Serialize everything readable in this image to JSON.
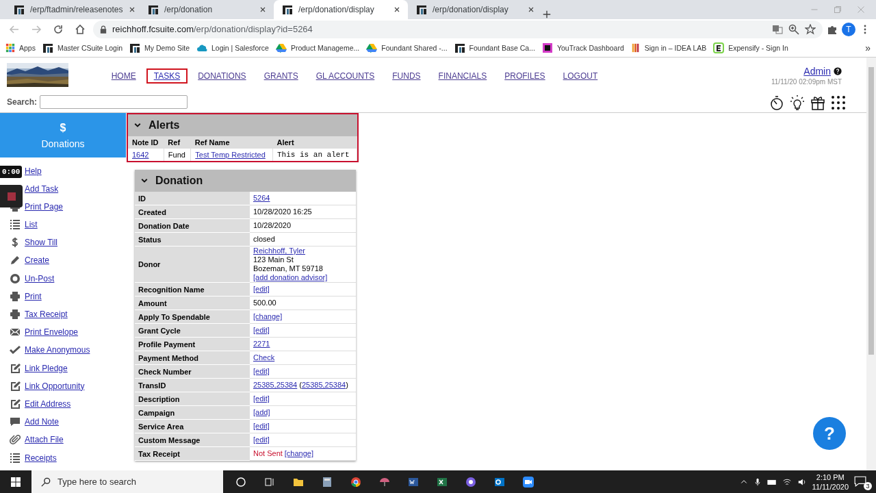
{
  "browser": {
    "tabs": [
      {
        "title": "/erp/ftadmin/releasenotes",
        "selected": false
      },
      {
        "title": "/erp/donation",
        "selected": false
      },
      {
        "title": "/erp/donation/display",
        "selected": true
      },
      {
        "title": "/erp/donation/display",
        "selected": false
      }
    ],
    "address": {
      "domain": "reichhoff.fcsuite.com",
      "path": "/erp/donation/display?id=5264"
    },
    "profile": "T",
    "bookmarks": [
      {
        "label": "Apps",
        "kind": "apps"
      },
      {
        "label": "Master CSuite Login",
        "kind": "site"
      },
      {
        "label": "My Demo Site",
        "kind": "site"
      },
      {
        "label": "Login | Salesforce",
        "kind": "cloud"
      },
      {
        "label": "Product Manageme...",
        "kind": "drive"
      },
      {
        "label": "Foundant Shared -...",
        "kind": "drive"
      },
      {
        "label": "Foundant Base Ca...",
        "kind": "site"
      },
      {
        "label": "YouTrack Dashboard",
        "kind": "youtrack"
      },
      {
        "label": "Sign in – IDEA LAB",
        "kind": "idea"
      },
      {
        "label": "Expensify - Sign In",
        "kind": "expensify"
      }
    ],
    "more": "»"
  },
  "header": {
    "nav": [
      {
        "label": "HOME",
        "selected": false
      },
      {
        "label": "TASKS",
        "selected": true
      },
      {
        "label": "DONATIONS",
        "selected": false
      },
      {
        "label": "GRANTS",
        "selected": false
      },
      {
        "label": "GL ACCOUNTS",
        "selected": false
      },
      {
        "label": "FUNDS",
        "selected": false
      },
      {
        "label": "FINANCIALS",
        "selected": false
      },
      {
        "label": "PROFILES",
        "selected": false
      },
      {
        "label": "LOGOUT",
        "selected": false
      }
    ],
    "user": "Admin",
    "timestamp": "11/11/20 02:09pm MST",
    "search_label": "Search:"
  },
  "sidebar": {
    "symbol": "$",
    "title": "Donations",
    "items": [
      "Help",
      "Add Task",
      "Print Page",
      "List",
      "Show Till",
      "Create",
      "Un-Post",
      "Print",
      "Tax Receipt",
      "Print Envelope",
      "Make Anonymous",
      "Link Pledge",
      "Link Opportunity",
      "Edit Address",
      "Add Note",
      "Attach File",
      "Receipts"
    ]
  },
  "alerts": {
    "title": "Alerts",
    "columns": [
      "Note ID",
      "Ref",
      "Ref Name",
      "Alert"
    ],
    "rows": [
      [
        "1642",
        "Fund",
        "Test Temp Restricted",
        "This is an alert"
      ]
    ]
  },
  "donation": {
    "title": "Donation",
    "rows": [
      {
        "label": "ID",
        "lines": [
          [
            {
              "text": "5264",
              "kind": "link"
            }
          ]
        ]
      },
      {
        "label": "Created",
        "lines": [
          [
            {
              "text": "10/28/2020 16:25",
              "kind": "text"
            }
          ]
        ]
      },
      {
        "label": "Donation Date",
        "lines": [
          [
            {
              "text": "10/28/2020",
              "kind": "text"
            }
          ]
        ]
      },
      {
        "label": "Status",
        "lines": [
          [
            {
              "text": "closed",
              "kind": "text"
            }
          ]
        ]
      },
      {
        "label": "Donor",
        "lines": [
          [
            {
              "text": "Reichhoff, Tyler",
              "kind": "link"
            }
          ],
          [
            {
              "text": "123 Main St",
              "kind": "text"
            }
          ],
          [
            {
              "text": "Bozeman, MT 59718",
              "kind": "text"
            }
          ],
          [
            {
              "text": "[add donation advisor]",
              "kind": "link"
            }
          ]
        ]
      },
      {
        "label": "Recognition Name",
        "lines": [
          [
            {
              "text": "[edit]",
              "kind": "link"
            }
          ]
        ]
      },
      {
        "label": "Amount",
        "lines": [
          [
            {
              "text": "500.00",
              "kind": "text"
            }
          ]
        ]
      },
      {
        "label": "Apply To Spendable",
        "lines": [
          [
            {
              "text": "[change]",
              "kind": "link"
            }
          ]
        ]
      },
      {
        "label": "Grant Cycle",
        "lines": [
          [
            {
              "text": "[edit]",
              "kind": "link"
            }
          ]
        ]
      },
      {
        "label": "Profile Payment",
        "lines": [
          [
            {
              "text": "2271",
              "kind": "link"
            }
          ]
        ]
      },
      {
        "label": "Payment Method",
        "lines": [
          [
            {
              "text": "Check",
              "kind": "link"
            }
          ]
        ]
      },
      {
        "label": "Check Number",
        "lines": [
          [
            {
              "text": "[edit]",
              "kind": "link"
            }
          ]
        ]
      },
      {
        "label": "TransID",
        "lines": [
          [
            {
              "text": "25385,25384",
              "kind": "link"
            },
            {
              "text": "(",
              "kind": "text"
            },
            {
              "text": "25385,25384",
              "kind": "link",
              "attached": true
            },
            {
              "text": ")",
              "kind": "text",
              "attached": true
            }
          ]
        ]
      },
      {
        "label": "Description",
        "lines": [
          [
            {
              "text": "[edit]",
              "kind": "link"
            }
          ]
        ]
      },
      {
        "label": "Campaign",
        "lines": [
          [
            {
              "text": "[add]",
              "kind": "link"
            }
          ]
        ]
      },
      {
        "label": "Service Area",
        "lines": [
          [
            {
              "text": "[edit]",
              "kind": "link"
            }
          ]
        ]
      },
      {
        "label": "Custom Message",
        "lines": [
          [
            {
              "text": "[edit]",
              "kind": "link"
            }
          ]
        ]
      },
      {
        "label": "Tax Receipt",
        "lines": [
          [
            {
              "text": "Not Sent",
              "kind": "warning"
            },
            {
              "text": "[change]",
              "kind": "link"
            }
          ]
        ]
      }
    ]
  },
  "recorder": {
    "time": "0:00"
  },
  "help_button": "?",
  "taskbar": {
    "search_placeholder": "Type here to search",
    "time": "2:10 PM",
    "date": "11/11/2020",
    "notifications": "3"
  }
}
